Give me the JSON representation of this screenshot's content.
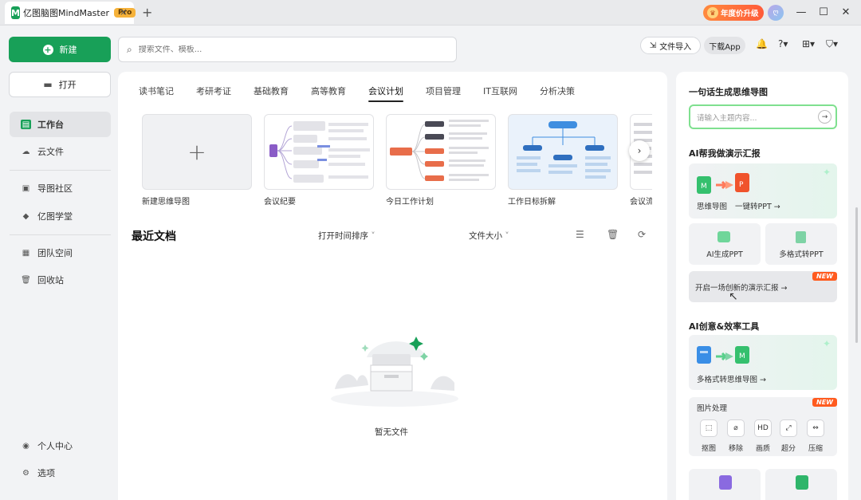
{
  "app": {
    "title": "亿图脑图MindMaster",
    "badge": "Pro",
    "close_tab": "×",
    "new_tab": "+"
  },
  "titlebar": {
    "vip_label": "年度价升级",
    "avatar": "ღ",
    "minimize": "—",
    "maximize": "☐",
    "close": "✕"
  },
  "sidebar": {
    "new_label": "新建",
    "open_label": "打开",
    "items": [
      {
        "label": "工作台",
        "icon": "workbench-icon"
      },
      {
        "label": "云文件",
        "icon": "cloud-icon"
      },
      {
        "label": "导图社区",
        "icon": "community-icon"
      },
      {
        "label": "亿图学堂",
        "icon": "school-icon"
      },
      {
        "label": "团队空间",
        "icon": "team-icon"
      },
      {
        "label": "回收站",
        "icon": "trash-icon"
      }
    ],
    "bottom": [
      {
        "label": "个人中心",
        "icon": "user-icon"
      },
      {
        "label": "选项",
        "icon": "gear-icon"
      }
    ]
  },
  "topbar": {
    "search_placeholder": "搜索文件、模板...",
    "import_label": "文件导入",
    "download_label": "下载App"
  },
  "categories": [
    "读书笔记",
    "考研考证",
    "基础教育",
    "高等教育",
    "会议计划",
    "项目管理",
    "IT互联网",
    "分析决策"
  ],
  "active_category": "会议计划",
  "templates": [
    {
      "label": "新建思维导图"
    },
    {
      "label": "会议纪要"
    },
    {
      "label": "今日工作计划"
    },
    {
      "label": "工作日标拆解"
    },
    {
      "label": "会议流"
    }
  ],
  "recent": {
    "title": "最近文档",
    "sort_label": "打开时间排序",
    "size_label": "文件大小",
    "empty_text": "暂无文件"
  },
  "ai_panel": {
    "heading_1": "一句话生成思维导图",
    "input_placeholder": "请输入主题内容...",
    "heading_2": "AI帮我做演示汇报",
    "big_card_1": {
      "from": "思维导图",
      "to": "一键转PPT →"
    },
    "small_cards": [
      "AI生成PPT",
      "多格式转PPT"
    ],
    "start_label": "开启一场创新的演示汇报 →",
    "new_tag": "NEW",
    "heading_3": "AI创意&效率工具",
    "big_card_2": "多格式转思维导图 →",
    "image_tool": {
      "title": "图片处理",
      "tools": [
        "抠图",
        "移除",
        "画质",
        "超分",
        "压缩"
      ]
    }
  },
  "colors": {
    "brand": "#18a058",
    "new_tag": "#ff5b1f",
    "vip": "#ff6a3a"
  }
}
